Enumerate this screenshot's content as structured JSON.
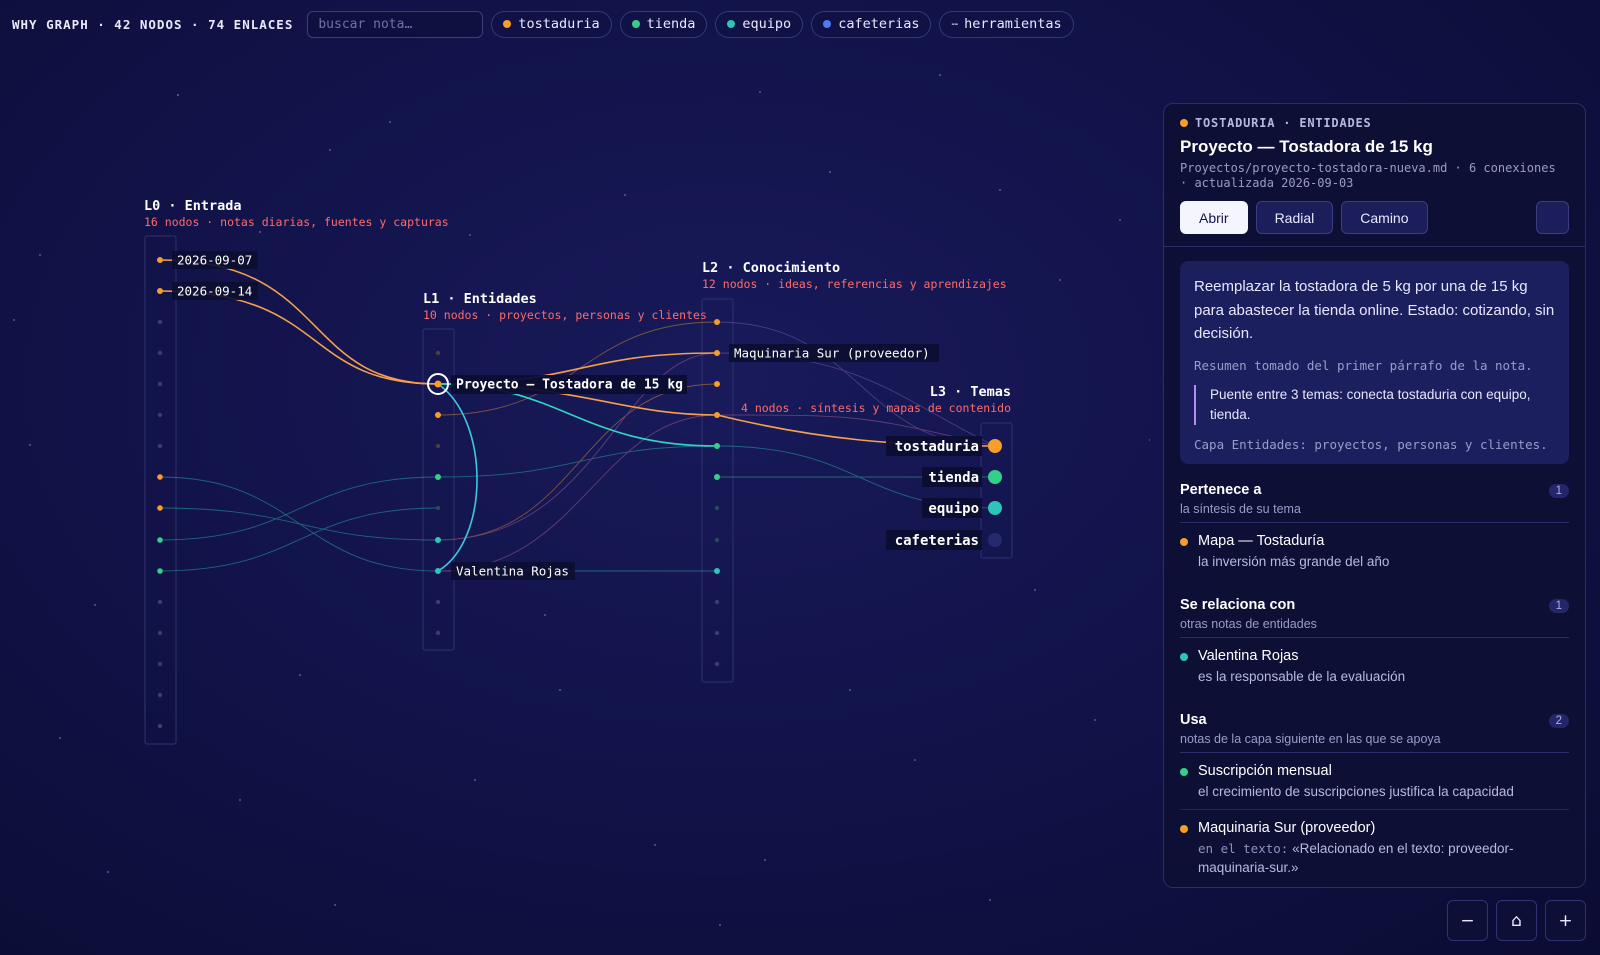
{
  "header": {
    "title": "WHY GRAPH · 42 NODOS · 74 ENLACES",
    "search_placeholder": "buscar nota…",
    "chips": [
      {
        "label": "tostaduria",
        "color": "#f59e2a"
      },
      {
        "label": "tienda",
        "color": "#34d08a"
      },
      {
        "label": "equipo",
        "color": "#2cc5b8"
      },
      {
        "label": "cafeterias",
        "color": "#4c7cf0"
      },
      {
        "label": "herramientas",
        "icon": "dash-icon"
      }
    ]
  },
  "colors": {
    "tostaduria": "#f59e2a",
    "tienda": "#34d08a",
    "equipo": "#2cc5b8",
    "cafeterias": "#2d3a8a",
    "link_orange": "#f5a04a",
    "link_cyan": "#3ec8e0",
    "layer_subtitle": "#ff6b6b"
  },
  "layers": [
    {
      "id": "l0",
      "title": "L0 · Entrada",
      "subtitle": "16 nodos · notas diarias, fuentes y capturas"
    },
    {
      "id": "l1",
      "title": "L1 · Entidades",
      "subtitle": "10 nodos · proyectos, personas y clientes"
    },
    {
      "id": "l2",
      "title": "L2 · Conocimiento",
      "subtitle": "12 nodos · ideas, referencias y aprendizajes"
    },
    {
      "id": "l3",
      "title": "L3 · Temas",
      "subtitle": "4 nodos · síntesis y mapas de contenido"
    }
  ],
  "nodes": {
    "l0_a": "2026-09-07",
    "l0_b": "2026-09-14",
    "l1_selected": "Proyecto — Tostadora de 15 kg",
    "l1_person": "Valentina Rojas",
    "l2_supplier": "Maquinaria Sur (proveedor)",
    "l3_tostaduria": "tostaduria",
    "l3_tienda": "tienda",
    "l3_equipo": "equipo",
    "l3_cafeterias": "cafeterias"
  },
  "panel": {
    "crumb": "TOSTADURIA · ENTIDADES",
    "title": "Proyecto — Tostadora de 15 kg",
    "meta": "Proyectos/proyecto-tostadora-nueva.md · 6 conexiones · actualizada 2026-09-03",
    "buttons": {
      "open": "Abrir",
      "radial": "Radial",
      "path": "Camino"
    },
    "summary": "Reemplazar la tostadora de 5 kg por una de 15 kg para abastecer la tienda online. Estado: cotizando, sin decisión.",
    "summary_note": "Resumen tomado del primer párrafo de la nota.",
    "bridge": "Puente entre 3 temas: conecta tostaduria con equipo, tienda.",
    "layer_note": "Capa Entidades: proyectos, personas y clientes.",
    "sections": [
      {
        "title": "Pertenece a",
        "subtitle": "la síntesis de su tema",
        "count": "1",
        "items": [
          {
            "title": "Mapa — Tostaduría",
            "sub": "la inversión más grande del año",
            "color": "#f59e2a"
          }
        ]
      },
      {
        "title": "Se relaciona con",
        "subtitle": "otras notas de entidades",
        "count": "1",
        "items": [
          {
            "title": "Valentina Rojas",
            "sub": "es la responsable de la evaluación",
            "color": "#2cc5b8"
          }
        ]
      },
      {
        "title": "Usa",
        "subtitle": "notas de la capa siguiente en las que se apoya",
        "count": "2",
        "items": [
          {
            "title": "Suscripción mensual",
            "sub": "el crecimiento de suscripciones justifica la capacidad",
            "color": "#34d08a"
          },
          {
            "title": "Maquinaria Sur (proveedor)",
            "sub_prefix": "en el texto:",
            "sub": "«Relacionado en el texto: proveedor-maquinaria-sur.»",
            "color": "#f59e2a"
          }
        ]
      }
    ]
  },
  "zoom": {
    "out": "−",
    "home": "⌂",
    "in": "+"
  }
}
